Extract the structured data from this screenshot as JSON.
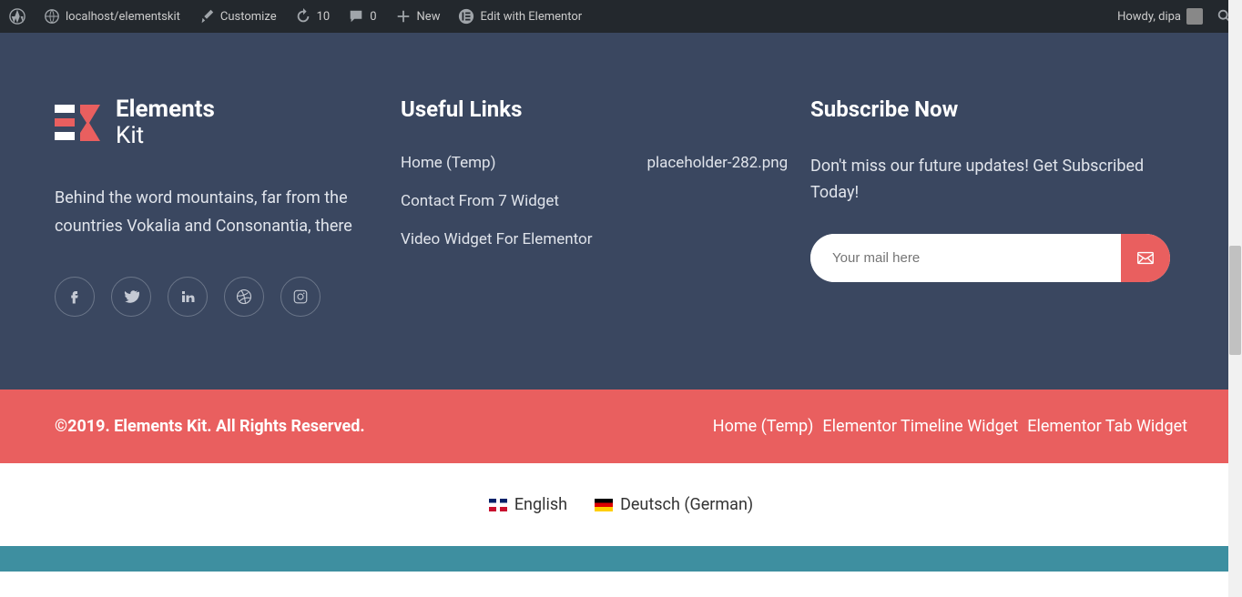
{
  "adminBar": {
    "siteName": "localhost/elementskit",
    "customize": "Customize",
    "updateCount": "10",
    "commentCount": "0",
    "newLabel": "New",
    "editWith": "Edit with Elementor",
    "greeting": "Howdy, dipa"
  },
  "footer": {
    "logo": {
      "line1": "Elements",
      "line2": "Kit"
    },
    "description": "Behind the word mountains, far from the countries Vokalia and Consonantia, there",
    "usefulLinksHeading": "Useful Links",
    "links": {
      "col1": [
        "Home (Temp)",
        "Contact From 7 Widget",
        "Video Widget For Elementor"
      ],
      "col2": [
        "placeholder-282.png"
      ]
    },
    "subscribe": {
      "heading": "Subscribe Now",
      "text": "Don't miss our future updates! Get Subscribed Today!",
      "placeholder": "Your mail here"
    }
  },
  "copyright": {
    "text": "©2019. Elements Kit. All Rights Reserved.",
    "links": [
      "Home (Temp)",
      "Elementor Timeline Widget",
      "Elementor Tab Widget"
    ]
  },
  "languages": {
    "en": "English",
    "de": "Deutsch (German)"
  }
}
